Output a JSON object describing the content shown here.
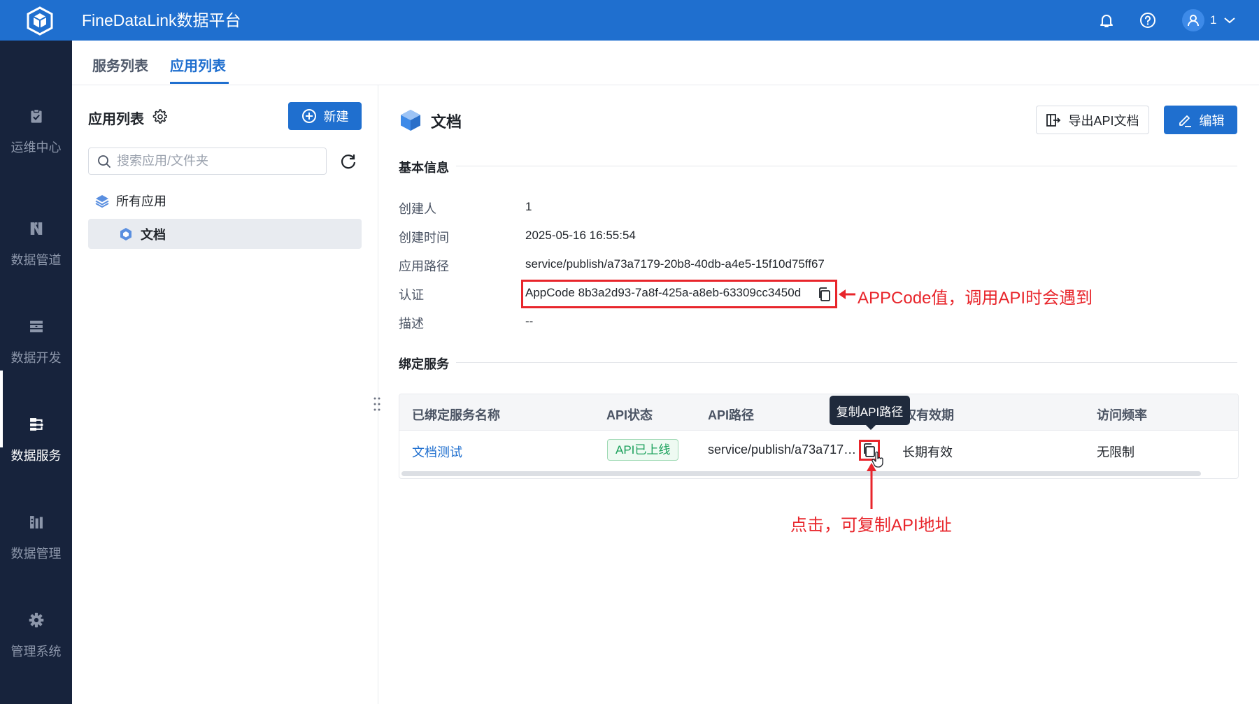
{
  "topbar": {
    "title": "FineDataLink数据平台",
    "bell_icon": "bell-icon",
    "help_icon": "help-icon",
    "user": {
      "name": "1"
    }
  },
  "nav": {
    "items": [
      {
        "label": "运维中心",
        "icon": "clipboard-check-icon"
      },
      {
        "label": "数据管道",
        "icon": "pipeline-icon"
      },
      {
        "label": "数据开发",
        "icon": "dev-icon"
      },
      {
        "label": "数据服务",
        "icon": "service-icon",
        "active": true
      },
      {
        "label": "数据管理",
        "icon": "data-manage-icon"
      },
      {
        "label": "管理系统",
        "icon": "gear-icon"
      }
    ]
  },
  "tabs": [
    {
      "label": "服务列表",
      "active": false
    },
    {
      "label": "应用列表",
      "active": true
    }
  ],
  "sidebar": {
    "title": "应用列表",
    "new_button": "新建",
    "search_placeholder": "搜索应用/文件夹",
    "tree_root": "所有应用",
    "tree_item": "文档"
  },
  "detail": {
    "title": "文档",
    "export_button": "导出API文档",
    "edit_button": "编辑",
    "basic_section": "基本信息",
    "fields": [
      {
        "label": "创建人",
        "value": "1"
      },
      {
        "label": "创建时间",
        "value": "2025-05-16 16:55:54"
      },
      {
        "label": "应用路径",
        "value": "service/publish/a73a7179-20b8-40db-a4e5-15f10d75ff67"
      },
      {
        "label": "认证",
        "value": "AppCode 8b3a2d93-7a8f-425a-a8eb-63309cc3450d"
      },
      {
        "label": "描述",
        "value": "--"
      }
    ],
    "binding_section": "绑定服务"
  },
  "table": {
    "columns": [
      "已绑定服务名称",
      "API状态",
      "API路径",
      "授权有效期",
      "访问频率"
    ],
    "rows": [
      {
        "name": "文档测试",
        "status": "API已上线",
        "path": "service/publish/a73a717…",
        "validity": "长期有效",
        "frequency": "无限制"
      }
    ],
    "tooltip": "复制API路径",
    "header_validity_visible": "权有效期"
  },
  "annotations": {
    "appcode_note": "APPCode值，调用API时会遇到",
    "copy_note": "点击，可复制API地址",
    "color": "#e8252b"
  },
  "colors": {
    "primary": "#1f6fcf",
    "nav_bg": "#17233c",
    "success": "#19a05a"
  }
}
